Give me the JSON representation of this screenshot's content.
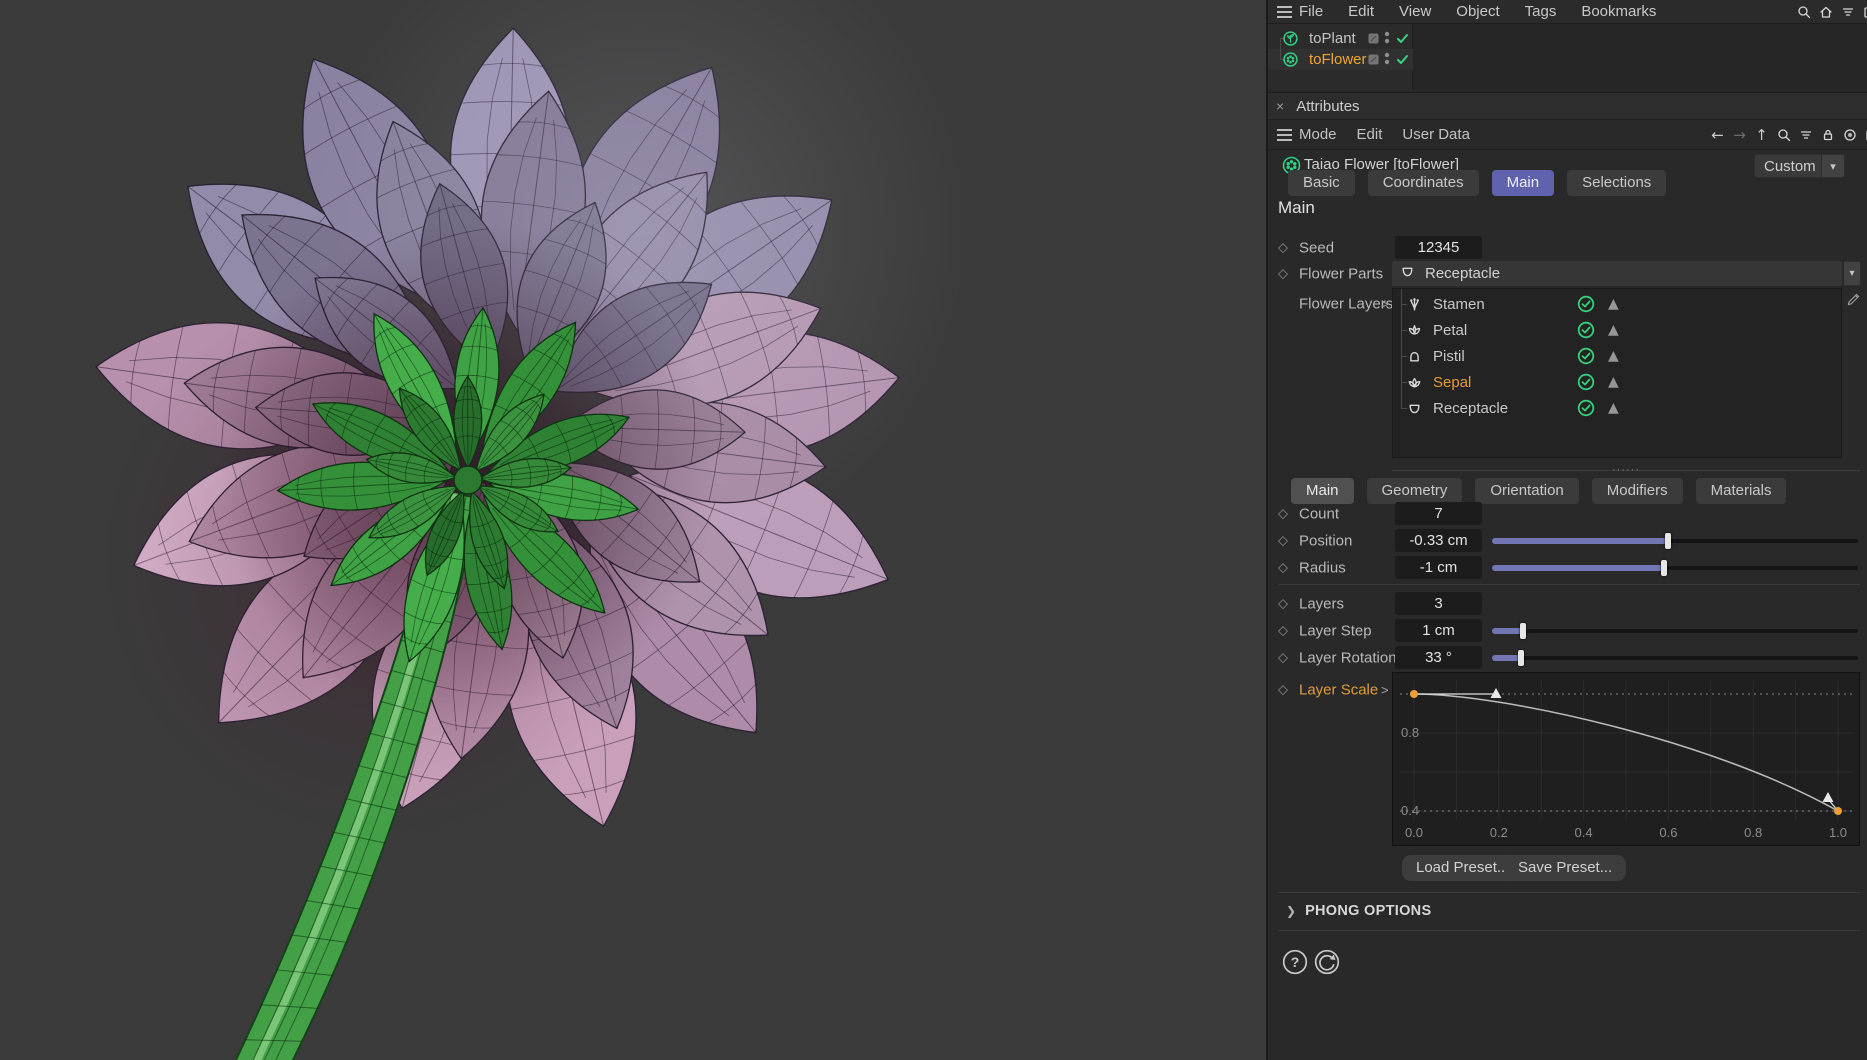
{
  "object_menu": {
    "items": [
      "File",
      "Edit",
      "View",
      "Object",
      "Tags",
      "Bookmarks"
    ],
    "right_icons": [
      "search",
      "home",
      "filter",
      "open-external"
    ]
  },
  "object_tree": [
    {
      "label": "toPlant",
      "icon": "plant",
      "selected": false
    },
    {
      "label": "toFlower",
      "icon": "flower",
      "selected": true
    }
  ],
  "attributes": {
    "panel_title": "Attributes",
    "menu_items": [
      "Mode",
      "Edit",
      "User Data"
    ],
    "nav_icons": [
      "back",
      "forward",
      "up",
      "search",
      "filter",
      "lock",
      "track",
      "open-external"
    ],
    "object_header": {
      "title": "Taiao Flower [toFlower]",
      "preset": "Custom"
    },
    "tabs": {
      "items": [
        "Basic",
        "Coordinates",
        "Main",
        "Selections"
      ],
      "active": "Main"
    },
    "section_title": "Main",
    "seed": {
      "label": "Seed",
      "value": "12345"
    },
    "flower_parts": {
      "label": "Flower Parts",
      "value": "Receptacle"
    },
    "flower_layers": {
      "label": "Flower Layers",
      "items": [
        {
          "name": "Stamen",
          "icon": "stamen",
          "enabled": true,
          "selected": false
        },
        {
          "name": "Petal",
          "icon": "petal",
          "enabled": true,
          "selected": false
        },
        {
          "name": "Pistil",
          "icon": "pistil",
          "enabled": true,
          "selected": false
        },
        {
          "name": "Sepal",
          "icon": "sepal",
          "enabled": true,
          "selected": true
        },
        {
          "name": "Receptacle",
          "icon": "receptacle",
          "enabled": true,
          "selected": false
        }
      ]
    },
    "sub_tabs": {
      "items": [
        "Main",
        "Geometry",
        "Orientation",
        "Modifiers",
        "Materials"
      ],
      "active": "Main"
    },
    "parameters": [
      {
        "label": "Count",
        "value": "7",
        "has_slider": false,
        "group": 1
      },
      {
        "label": "Position",
        "value": "-0.33 cm",
        "has_slider": true,
        "slider_pos": 0.48,
        "group": 1
      },
      {
        "label": "Radius",
        "value": "-1 cm",
        "has_slider": true,
        "slider_pos": 0.47,
        "group": 1
      },
      {
        "label": "Layers",
        "value": "3",
        "has_slider": false,
        "group": 2
      },
      {
        "label": "Layer Step",
        "value": "1 cm",
        "has_slider": true,
        "slider_pos": 0.085,
        "group": 2
      },
      {
        "label": "Layer Rotation",
        "value": "33 °",
        "has_slider": true,
        "slider_pos": 0.08,
        "group": 2
      }
    ],
    "layer_scale": {
      "label": "Layer Scale",
      "curve": {
        "type": "line",
        "points": [
          {
            "x": 0.0,
            "y": 1.0
          },
          {
            "x": 1.0,
            "y": 0.4
          }
        ],
        "x_ticks": [
          "0.0",
          "0.2",
          "0.4",
          "0.6",
          "0.8",
          "1.0"
        ],
        "y_ticks": [
          {
            "value": 0.8,
            "label": "0.8"
          },
          {
            "value": 0.4,
            "label": "0.4"
          }
        ],
        "xlim": [
          0,
          1
        ],
        "ylim": [
          0.35,
          1.05
        ]
      }
    },
    "preset_buttons": [
      "Load Preset...",
      "Save Preset..."
    ],
    "phong_section": "PHONG OPTIONS",
    "footer_icons": [
      "help",
      "reset"
    ]
  },
  "colors": {
    "accent_orange": "#e9a13b",
    "accent_green": "#35d07a",
    "tab_active_blue": "#6062ae",
    "slider_fill": "#7276b4",
    "viewport_bg": "#3b3b3b"
  },
  "viewport": {
    "content": "wireframe dahlia flower seen from behind: pink and purple petals, green sepal rosette, green stem"
  }
}
